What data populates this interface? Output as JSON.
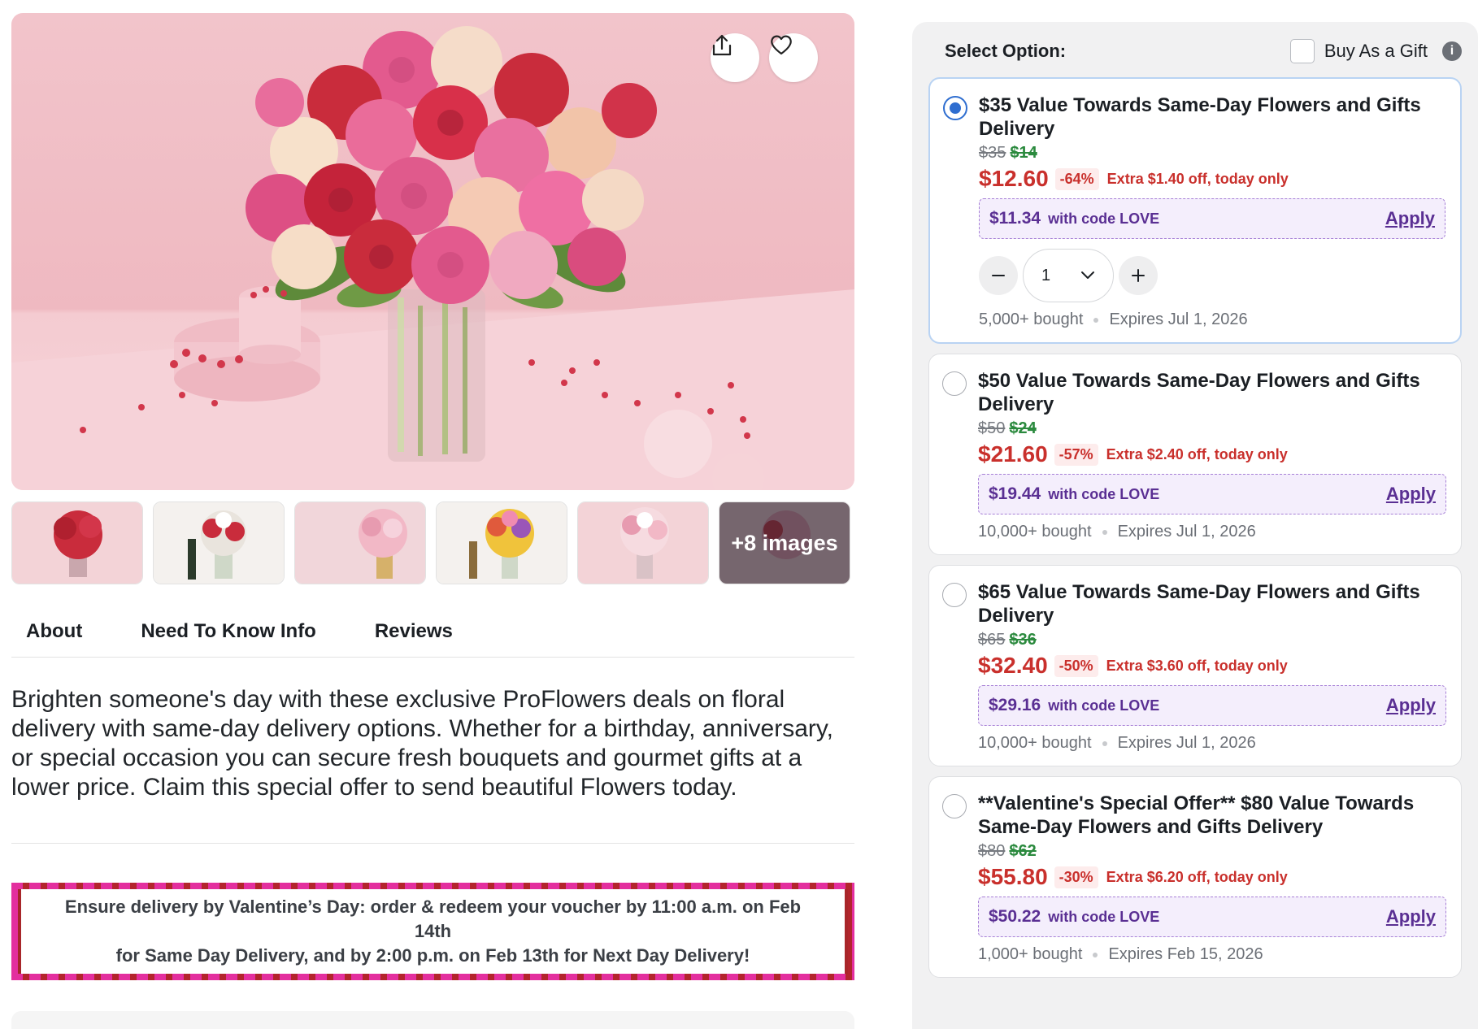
{
  "gallery": {
    "more_label": "+8 images"
  },
  "tabs": [
    "About",
    "Need To Know Info",
    "Reviews"
  ],
  "description": "Brighten someone's day with these exclusive ProFlowers deals on floral delivery with same-day delivery options. Whether for a birthday, anniversary, or special occasion you can secure fresh bouquets and gourmet gifts at a lower price. Claim this special offer to send beautiful Flowers today.",
  "banner": {
    "line1": "Ensure delivery by Valentine’s Day: order & redeem your voucher by 11:00 a.m. on Feb 14th",
    "line2": "for Same Day Delivery, and by 2:00 p.m. on Feb 13th for Next Day Delivery!"
  },
  "panel": {
    "title": "Select Option:",
    "gift_label": "Buy As a Gift",
    "info_glyph": "i"
  },
  "options": [
    {
      "title": "$35 Value Towards Same-Day Flowers and Gifts Delivery",
      "original": "$35",
      "was": "$14",
      "now": "$12.60",
      "discount": "-64%",
      "extra": "Extra $1.40 off, today only",
      "code_price": "$11.34",
      "code_text": "with code LOVE",
      "apply": "Apply",
      "quantity": "1",
      "bought": "5,000+ bought",
      "expires": "Expires Jul 1, 2026",
      "selected": true
    },
    {
      "title": "$50 Value Towards Same-Day Flowers and Gifts Delivery",
      "original": "$50",
      "was": "$24",
      "now": "$21.60",
      "discount": "-57%",
      "extra": "Extra $2.40 off, today only",
      "code_price": "$19.44",
      "code_text": "with code LOVE",
      "apply": "Apply",
      "bought": "10,000+ bought",
      "expires": "Expires Jul 1, 2026",
      "selected": false
    },
    {
      "title": "$65 Value Towards Same-Day Flowers and Gifts Delivery",
      "original": "$65",
      "was": "$36",
      "now": "$32.40",
      "discount": "-50%",
      "extra": "Extra $3.60 off, today only",
      "code_price": "$29.16",
      "code_text": "with code LOVE",
      "apply": "Apply",
      "bought": "10,000+ bought",
      "expires": "Expires Jul 1, 2026",
      "selected": false
    },
    {
      "title": "**Valentine's Special Offer** $80 Value Towards Same-Day Flowers and Gifts Delivery",
      "original": "$80",
      "was": "$62",
      "now": "$55.80",
      "discount": "-30%",
      "extra": "Extra $6.20 off, today only",
      "code_price": "$50.22",
      "code_text": "with code LOVE",
      "apply": "Apply",
      "bought": "1,000+ bought",
      "expires": "Expires Feb 15, 2026",
      "selected": false
    }
  ],
  "colors": {
    "accent_blue": "#2f6ed0",
    "price_red": "#c9302c",
    "was_green": "#2b8a3e",
    "code_purple": "#5a2f93",
    "banner_pink": "#e32f9e",
    "banner_red": "#b3252c"
  },
  "icons": {
    "share": "share-icon",
    "favorite": "heart-icon",
    "minus": "minus-icon",
    "plus": "plus-icon",
    "dropdown": "chevron-down-icon",
    "info": "info-icon"
  }
}
